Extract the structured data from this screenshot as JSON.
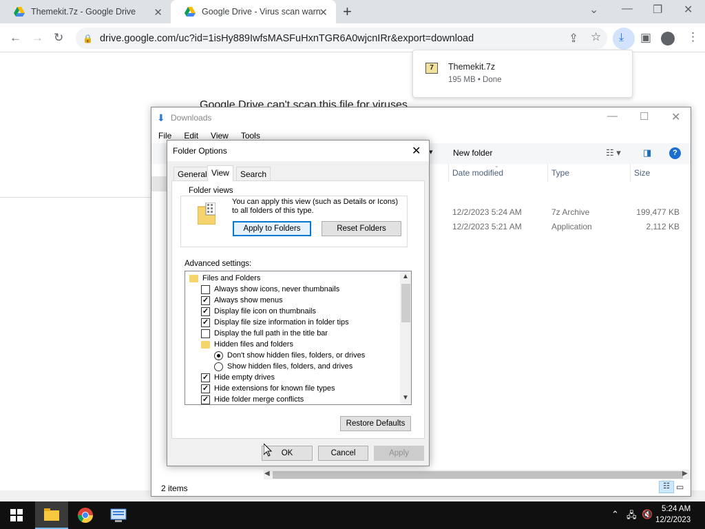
{
  "browser": {
    "tabs": [
      {
        "title": "Themekit.7z - Google Drive"
      },
      {
        "title": "Google Drive - Virus scan warnin"
      }
    ],
    "url": "drive.google.com/uc?id=1isHy889IwfsMASFuHxnTGR6A0wjcnIRr&export=download",
    "new_tab_label": "+"
  },
  "page": {
    "heading": "Google Drive can't scan this file for viruses."
  },
  "download_bubble": {
    "file_name": "Themekit.7z",
    "status": "195 MB • Done"
  },
  "explorer": {
    "title": "Downloads",
    "menu": [
      "File",
      "Edit",
      "View",
      "Tools"
    ],
    "new_folder_label": "New folder",
    "columns": {
      "date": "Date modified",
      "type": "Type",
      "size": "Size"
    },
    "rows": [
      {
        "date": "12/2/2023 5:24 AM",
        "type": "7z Archive",
        "size": "199,477 KB"
      },
      {
        "date": "12/2/2023 5:21 AM",
        "type": "Application",
        "size": "2,112 KB"
      }
    ],
    "status": "2 items"
  },
  "dialog": {
    "title": "Folder Options",
    "tabs": [
      "General",
      "View",
      "Search"
    ],
    "folder_views_label": "Folder views",
    "folder_views_desc": "You can apply this view (such as Details or Icons) to all folders of this type.",
    "apply_folders_label": "Apply to Folders",
    "reset_folders_label": "Reset Folders",
    "advanced_label": "Advanced settings:",
    "tree": [
      {
        "kind": "folder",
        "indent": 0,
        "label": "Files and Folders"
      },
      {
        "kind": "check",
        "indent": 1,
        "checked": false,
        "label": "Always show icons, never thumbnails"
      },
      {
        "kind": "check",
        "indent": 1,
        "checked": true,
        "label": "Always show menus"
      },
      {
        "kind": "check",
        "indent": 1,
        "checked": true,
        "label": "Display file icon on thumbnails"
      },
      {
        "kind": "check",
        "indent": 1,
        "checked": true,
        "label": "Display file size information in folder tips"
      },
      {
        "kind": "check",
        "indent": 1,
        "checked": false,
        "label": "Display the full path in the title bar"
      },
      {
        "kind": "folder",
        "indent": 1,
        "label": "Hidden files and folders"
      },
      {
        "kind": "radio",
        "indent": 2,
        "checked": true,
        "label": "Don't show hidden files, folders, or drives"
      },
      {
        "kind": "radio",
        "indent": 2,
        "checked": false,
        "label": "Show hidden files, folders, and drives"
      },
      {
        "kind": "check",
        "indent": 1,
        "checked": true,
        "label": "Hide empty drives"
      },
      {
        "kind": "check",
        "indent": 1,
        "checked": true,
        "label": "Hide extensions for known file types"
      },
      {
        "kind": "check",
        "indent": 1,
        "checked": true,
        "label": "Hide folder merge conflicts"
      }
    ],
    "restore_defaults_label": "Restore Defaults",
    "ok_label": "OK",
    "cancel_label": "Cancel",
    "apply_label": "Apply"
  },
  "taskbar": {
    "time": "5:24 AM",
    "date": "12/2/2023"
  },
  "colors": {
    "accent": "#0078d7",
    "taskbar": "#101010"
  }
}
